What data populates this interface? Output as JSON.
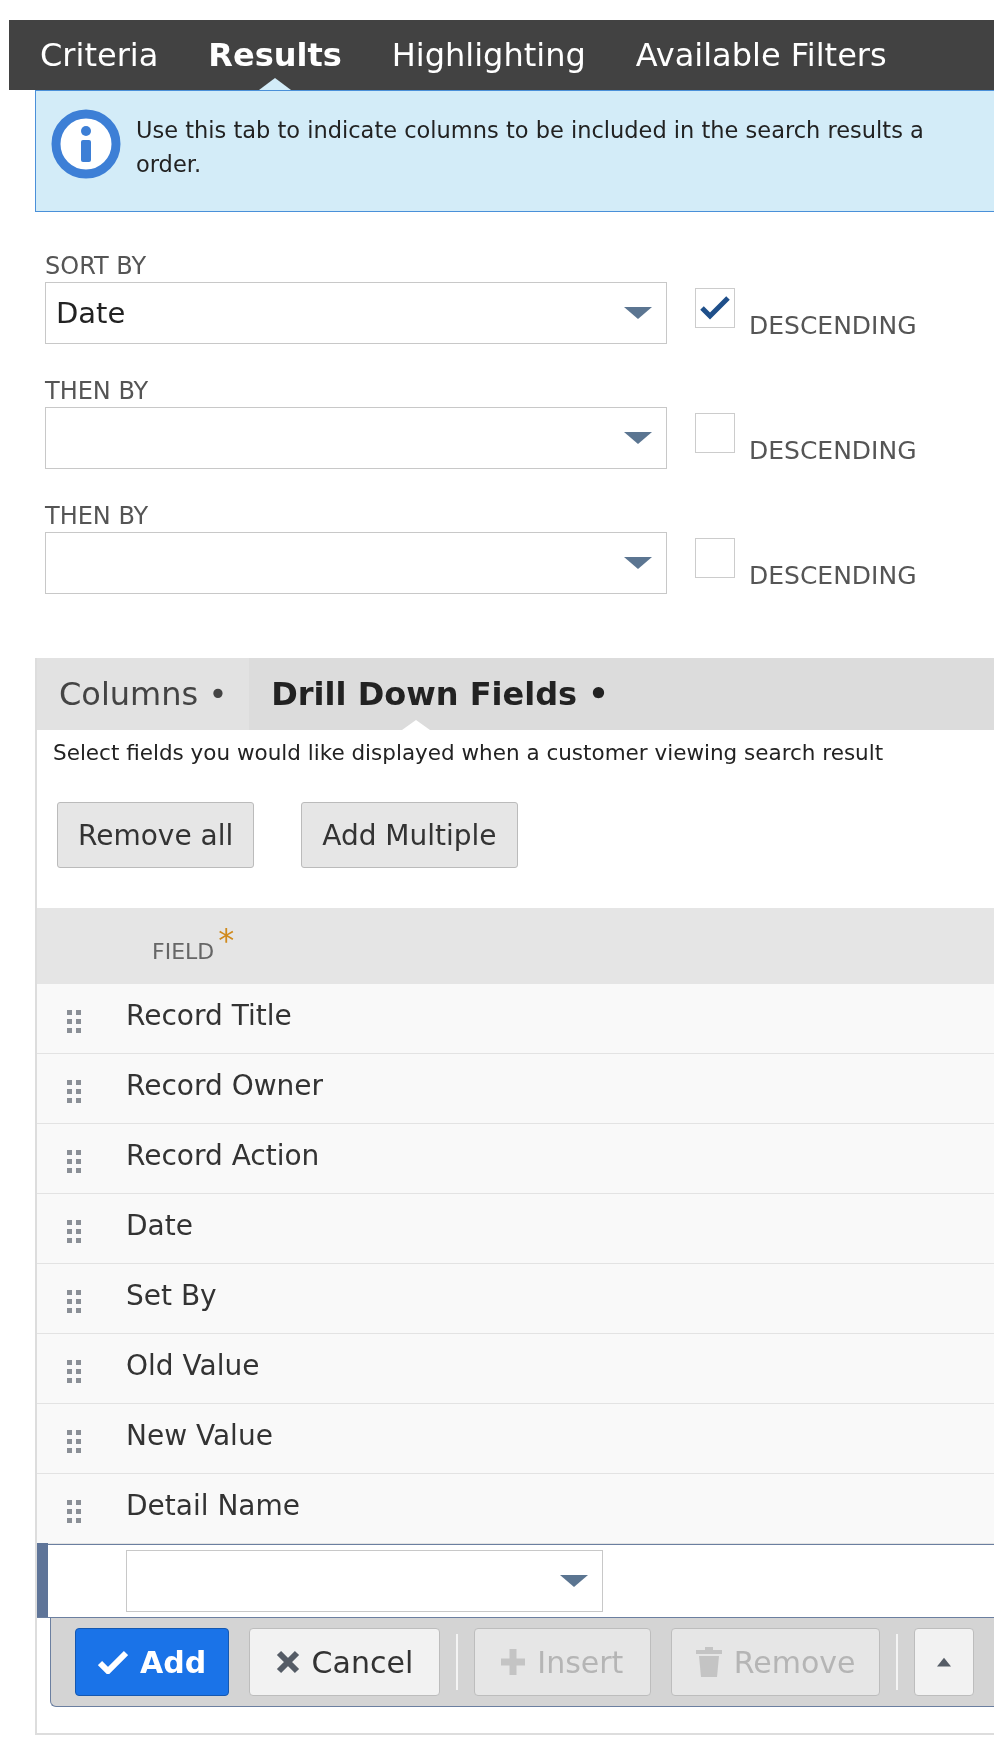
{
  "tabs": [
    {
      "label": "Criteria",
      "selected": false
    },
    {
      "label": "Results",
      "selected": true
    },
    {
      "label": "Highlighting",
      "selected": false
    },
    {
      "label": "Available Filters",
      "selected": false
    }
  ],
  "info": {
    "lines": [
      "Use this tab to indicate columns to be included in the search results a",
      "order."
    ]
  },
  "sort": [
    {
      "label": "SORT BY",
      "value": "Date",
      "descending": true,
      "descending_label": "DESCENDING"
    },
    {
      "label": "THEN BY",
      "descending": false,
      "descending_label": "DESCENDING"
    },
    {
      "label": "THEN BY",
      "descending": false,
      "descending_label": "DESCENDING"
    }
  ],
  "subtabs": [
    {
      "label": "Columns •",
      "selected": false
    },
    {
      "label": "Drill Down Fields •",
      "selected": true
    }
  ],
  "description": "Select fields you would like displayed when a customer viewing search result",
  "actions": [
    "Remove all",
    "Add Multiple"
  ],
  "table": {
    "columns": [
      {
        "label": "FIELD",
        "required_mark": "*"
      }
    ],
    "rows": [
      "Record Title",
      "Record Owner",
      "Record Action",
      "Date",
      "Set By",
      "Old Value",
      "New Value",
      "Detail Name"
    ]
  },
  "buttons": [
    {
      "kind": "add",
      "label": "Add",
      "disabled": false
    },
    {
      "kind": "cancel",
      "label": "Cancel",
      "disabled": false
    },
    {
      "kind": "insert",
      "label": "Insert",
      "disabled": true
    },
    {
      "kind": "remove",
      "label": "Remove",
      "disabled": true
    },
    {
      "kind": "move",
      "disabled": false
    }
  ]
}
